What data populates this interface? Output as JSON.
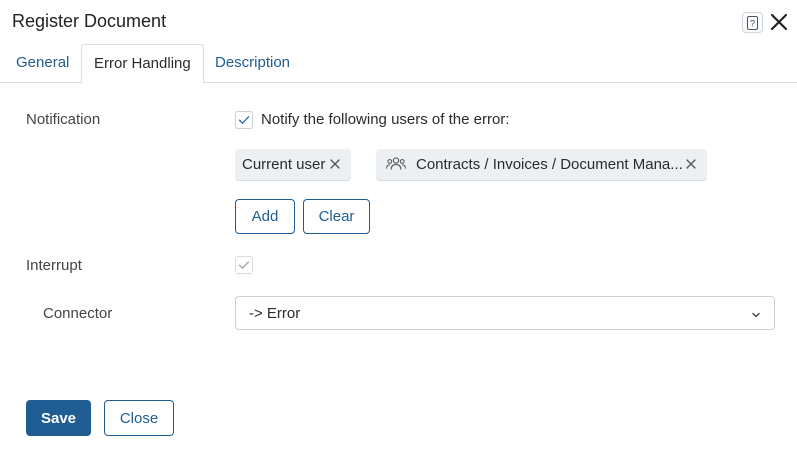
{
  "dialog": {
    "title": "Register Document"
  },
  "tabs": [
    {
      "label": "General"
    },
    {
      "label": "Error Handling"
    },
    {
      "label": "Description"
    }
  ],
  "notification": {
    "label": "Notification",
    "checkbox_label": "Notify the following users of the error:",
    "checked": true,
    "chips": [
      {
        "label": "Current user",
        "icon": "none"
      },
      {
        "label": "Contracts / Invoices / Document Mana...",
        "icon": "group-icon"
      }
    ],
    "add_label": "Add",
    "clear_label": "Clear"
  },
  "interrupt": {
    "label": "Interrupt",
    "checked": true
  },
  "connector": {
    "label": "Connector",
    "value": "-> Error"
  },
  "footer": {
    "save_label": "Save",
    "close_label": "Close"
  },
  "colors": {
    "accent": "#1f5d93",
    "chip_bg": "#edf0f3",
    "border": "#c9d0d7"
  }
}
